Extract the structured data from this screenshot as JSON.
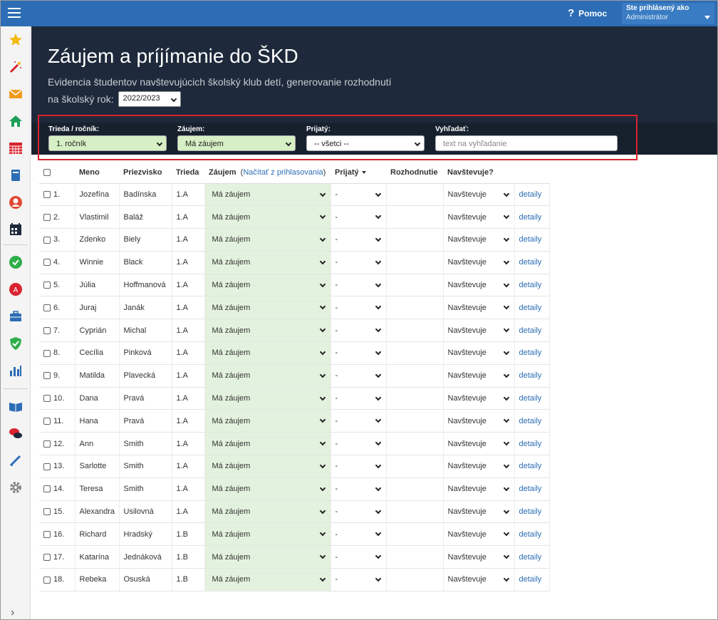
{
  "topbar": {
    "help_label": "Pomoc",
    "user_line1": "Ste prihlásený ako",
    "user_line2": "Administrátor"
  },
  "header": {
    "title": "Záujem a príjímanie do ŠKD",
    "subtitle": "Evidencia študentov navštevujúcich školský klub detí, generovanie rozhodnutí",
    "year_label": "na školský rok:",
    "year_value": "2022/2023"
  },
  "filters": {
    "trieda_label": "Trieda / ročník:",
    "trieda_value": "1. ročník",
    "zaujem_label": "Záujem:",
    "zaujem_value": "Má záujem",
    "prijaty_label": "Prijatý:",
    "prijaty_value": "-- všetci --",
    "search_label": "Vyhľadať:",
    "search_placeholder": "text na vyhľadanie"
  },
  "table": {
    "headers": {
      "meno": "Meno",
      "priezvisko": "Priezvisko",
      "trieda": "Trieda",
      "zaujem": "Záujem",
      "zaujem_link": "Načítať z prihlasovania",
      "prijaty": "Prijatý",
      "rozhodnutie": "Rozhodnutie",
      "navstevuje": "Navštevuje?"
    },
    "rows": [
      {
        "num": "1.",
        "meno": "Jozefína",
        "priezvisko": "Badínska",
        "trieda": "1.A",
        "zaujem": "Má záujem",
        "prijaty": "-",
        "navstevuje": "Navštevuje",
        "detail": "detaily"
      },
      {
        "num": "2.",
        "meno": "Vlastimil",
        "priezvisko": "Baláž",
        "trieda": "1.A",
        "zaujem": "Má záujem",
        "prijaty": "-",
        "navstevuje": "Navštevuje",
        "detail": "detaily"
      },
      {
        "num": "3.",
        "meno": "Zdenko",
        "priezvisko": "Biely",
        "trieda": "1.A",
        "zaujem": "Má záujem",
        "prijaty": "-",
        "navstevuje": "Navštevuje",
        "detail": "detaily"
      },
      {
        "num": "4.",
        "meno": "Winnie",
        "priezvisko": "Black",
        "trieda": "1.A",
        "zaujem": "Má záujem",
        "prijaty": "-",
        "navstevuje": "Navštevuje",
        "detail": "detaily"
      },
      {
        "num": "5.",
        "meno": "Júlia",
        "priezvisko": "Hoffmanová",
        "trieda": "1.A",
        "zaujem": "Má záujem",
        "prijaty": "-",
        "navstevuje": "Navštevuje",
        "detail": "detaily"
      },
      {
        "num": "6.",
        "meno": "Juraj",
        "priezvisko": "Janák",
        "trieda": "1.A",
        "zaujem": "Má záujem",
        "prijaty": "-",
        "navstevuje": "Navštevuje",
        "detail": "detaily"
      },
      {
        "num": "7.",
        "meno": "Cyprián",
        "priezvisko": "Michal",
        "trieda": "1.A",
        "zaujem": "Má záujem",
        "prijaty": "-",
        "navstevuje": "Navštevuje",
        "detail": "detaily"
      },
      {
        "num": "8.",
        "meno": "Cecília",
        "priezvisko": "Pinková",
        "trieda": "1.A",
        "zaujem": "Má záujem",
        "prijaty": "-",
        "navstevuje": "Navštevuje",
        "detail": "detaily"
      },
      {
        "num": "9.",
        "meno": "Matilda",
        "priezvisko": "Plavecká",
        "trieda": "1.A",
        "zaujem": "Má záujem",
        "prijaty": "-",
        "navstevuje": "Navštevuje",
        "detail": "detaily"
      },
      {
        "num": "10.",
        "meno": "Dana",
        "priezvisko": "Pravá",
        "trieda": "1.A",
        "zaujem": "Má záujem",
        "prijaty": "-",
        "navstevuje": "Navštevuje",
        "detail": "detaily"
      },
      {
        "num": "11.",
        "meno": "Hana",
        "priezvisko": "Pravá",
        "trieda": "1.A",
        "zaujem": "Má záujem",
        "prijaty": "-",
        "navstevuje": "Navštevuje",
        "detail": "detaily"
      },
      {
        "num": "12.",
        "meno": "Ann",
        "priezvisko": "Smith",
        "trieda": "1.A",
        "zaujem": "Má záujem",
        "prijaty": "-",
        "navstevuje": "Navštevuje",
        "detail": "detaily"
      },
      {
        "num": "13.",
        "meno": "Sarlotte",
        "priezvisko": "Smith",
        "trieda": "1.A",
        "zaujem": "Má záujem",
        "prijaty": "-",
        "navstevuje": "Navštevuje",
        "detail": "detaily"
      },
      {
        "num": "14.",
        "meno": "Teresa",
        "priezvisko": "Smith",
        "trieda": "1.A",
        "zaujem": "Má záujem",
        "prijaty": "-",
        "navstevuje": "Navštevuje",
        "detail": "detaily"
      },
      {
        "num": "15.",
        "meno": "Alexandra",
        "priezvisko": "Usilovná",
        "trieda": "1.A",
        "zaujem": "Má záujem",
        "prijaty": "-",
        "navstevuje": "Navštevuje",
        "detail": "detaily"
      },
      {
        "num": "16.",
        "meno": "Richard",
        "priezvisko": "Hradský",
        "trieda": "1.B",
        "zaujem": "Má záujem",
        "prijaty": "-",
        "navstevuje": "Navštevuje",
        "detail": "detaily"
      },
      {
        "num": "17.",
        "meno": "Katarína",
        "priezvisko": "Jednáková",
        "trieda": "1.B",
        "zaujem": "Má záujem",
        "prijaty": "-",
        "navstevuje": "Navštevuje",
        "detail": "detaily"
      },
      {
        "num": "18.",
        "meno": "Rebeka",
        "priezvisko": "Osuská",
        "trieda": "1.B",
        "zaujem": "Má záujem",
        "prijaty": "-",
        "navstevuje": "Navštevuje",
        "detail": "detaily"
      }
    ]
  },
  "sidebar": {
    "icons": [
      "star-icon",
      "magic-wand-icon",
      "mail-icon",
      "home-icon",
      "calendar-grid-icon",
      "book-icon",
      "user-icon",
      "schedule-icon",
      "check-circle-icon",
      "badge-icon",
      "briefcase-icon",
      "shield-check-icon",
      "bar-chart-icon",
      "open-book-icon",
      "chat-icon",
      "pen-icon",
      "gear-icon"
    ]
  },
  "colors": {
    "topbar": "#2c6db5",
    "header": "#1e2a3b",
    "accent_green": "#d6efc4",
    "highlight_red": "#d9232e"
  }
}
